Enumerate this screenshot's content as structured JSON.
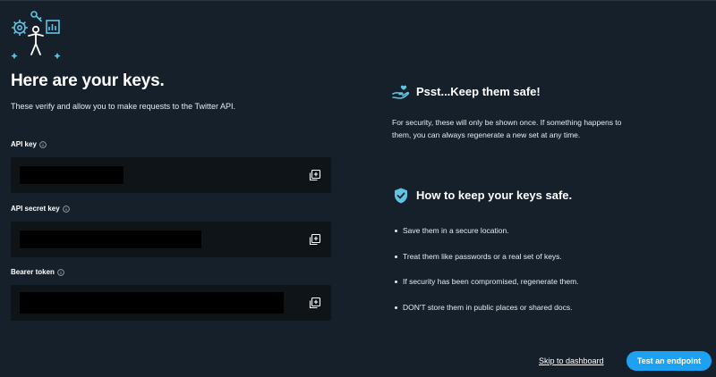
{
  "header": {
    "title": "Here are your keys.",
    "subtitle": "These verify and allow you to make requests to the Twitter API."
  },
  "fields": [
    {
      "label": "API key",
      "value_hidden": true,
      "copy_icon": "copy-icon"
    },
    {
      "label": "API secret key",
      "value_hidden": true,
      "copy_icon": "copy-icon"
    },
    {
      "label": "Bearer token",
      "value_hidden": true,
      "copy_icon": "copy-icon"
    }
  ],
  "safe_section": {
    "title": "Psst...Keep them safe!",
    "text": "For security, these will only be shown once. If something happens to them, you can always regenerate a new set at any time.",
    "icon": "hand-heart-icon"
  },
  "howto_section": {
    "title": "How to keep your keys safe.",
    "icon": "shield-check-icon",
    "tips": [
      "Save them in a secure location.",
      "Treat them like passwords or a real set of keys.",
      "If security has been compromised, regenerate them.",
      "DON'T store them in public places or shared docs."
    ]
  },
  "footer": {
    "skip_label": "Skip to dashboard",
    "test_label": "Test an endpoint"
  },
  "colors": {
    "background": "#15202b",
    "field_background": "#0f1419",
    "accent": "#1da1f2",
    "icon_accent": "#5fc3e4"
  }
}
